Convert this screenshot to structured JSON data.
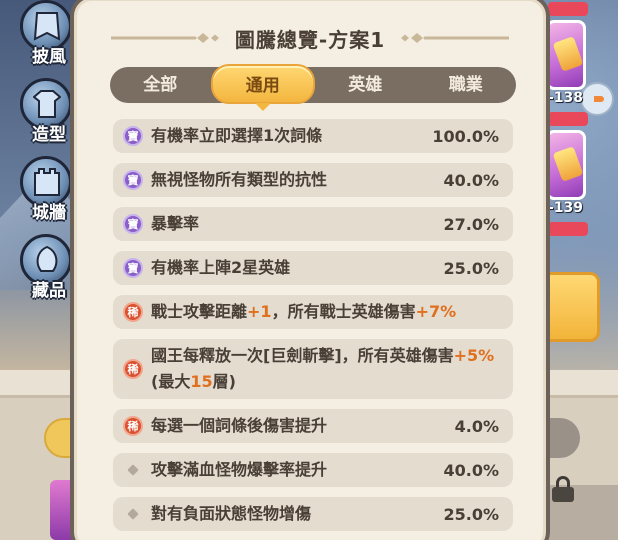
{
  "sidebar": {
    "items": [
      {
        "label": "披風",
        "icon": "cape-icon"
      },
      {
        "label": "造型",
        "icon": "outfit-icon"
      },
      {
        "label": "城牆",
        "icon": "wall-icon"
      },
      {
        "label": "藏品",
        "icon": "collection-icon"
      }
    ]
  },
  "right_cards": [
    {
      "number": "-138"
    },
    {
      "number": "-139"
    }
  ],
  "panel": {
    "title": "圖騰總覽-方案1",
    "tabs": [
      {
        "label": "全部",
        "active": false
      },
      {
        "label": "通用",
        "active": true
      },
      {
        "label": "英雄",
        "active": false
      },
      {
        "label": "職業",
        "active": false
      }
    ],
    "badges": {
      "treasure": "寶",
      "rare": "稀"
    },
    "rows": [
      {
        "badge": "treasure",
        "text": "有機率立即選擇1次詞條",
        "value": "100.0%"
      },
      {
        "badge": "treasure",
        "text": "無視怪物所有類型的抗性",
        "value": "40.0%"
      },
      {
        "badge": "treasure",
        "text": "暴擊率",
        "value": "27.0%"
      },
      {
        "badge": "treasure",
        "text": "有機率上陣2星英雄",
        "value": "25.0%"
      },
      {
        "badge": "rare",
        "parts": [
          "戰士攻擊距離",
          "+1",
          "，所有戰士英雄傷害",
          "+7%"
        ],
        "value": ""
      },
      {
        "badge": "rare",
        "parts": [
          "國王每釋放一次[巨劍斬擊]，所有英雄傷害",
          "+5%",
          "(最大",
          "15",
          "層)"
        ],
        "value": ""
      },
      {
        "badge": "rare",
        "text": "每選一個詞條後傷害提升",
        "value": "4.0%"
      },
      {
        "badge": "common",
        "text": "攻擊滿血怪物爆擊率提升",
        "value": "40.0%"
      },
      {
        "badge": "common",
        "text": "對有負面狀態怪物增傷",
        "value": "25.0%"
      }
    ]
  },
  "colors": {
    "accent_gold": "#f3b63f",
    "highlight_orange": "#e0701f",
    "treasure_purple": "#8a5fc9",
    "rare_red": "#d9512f"
  }
}
